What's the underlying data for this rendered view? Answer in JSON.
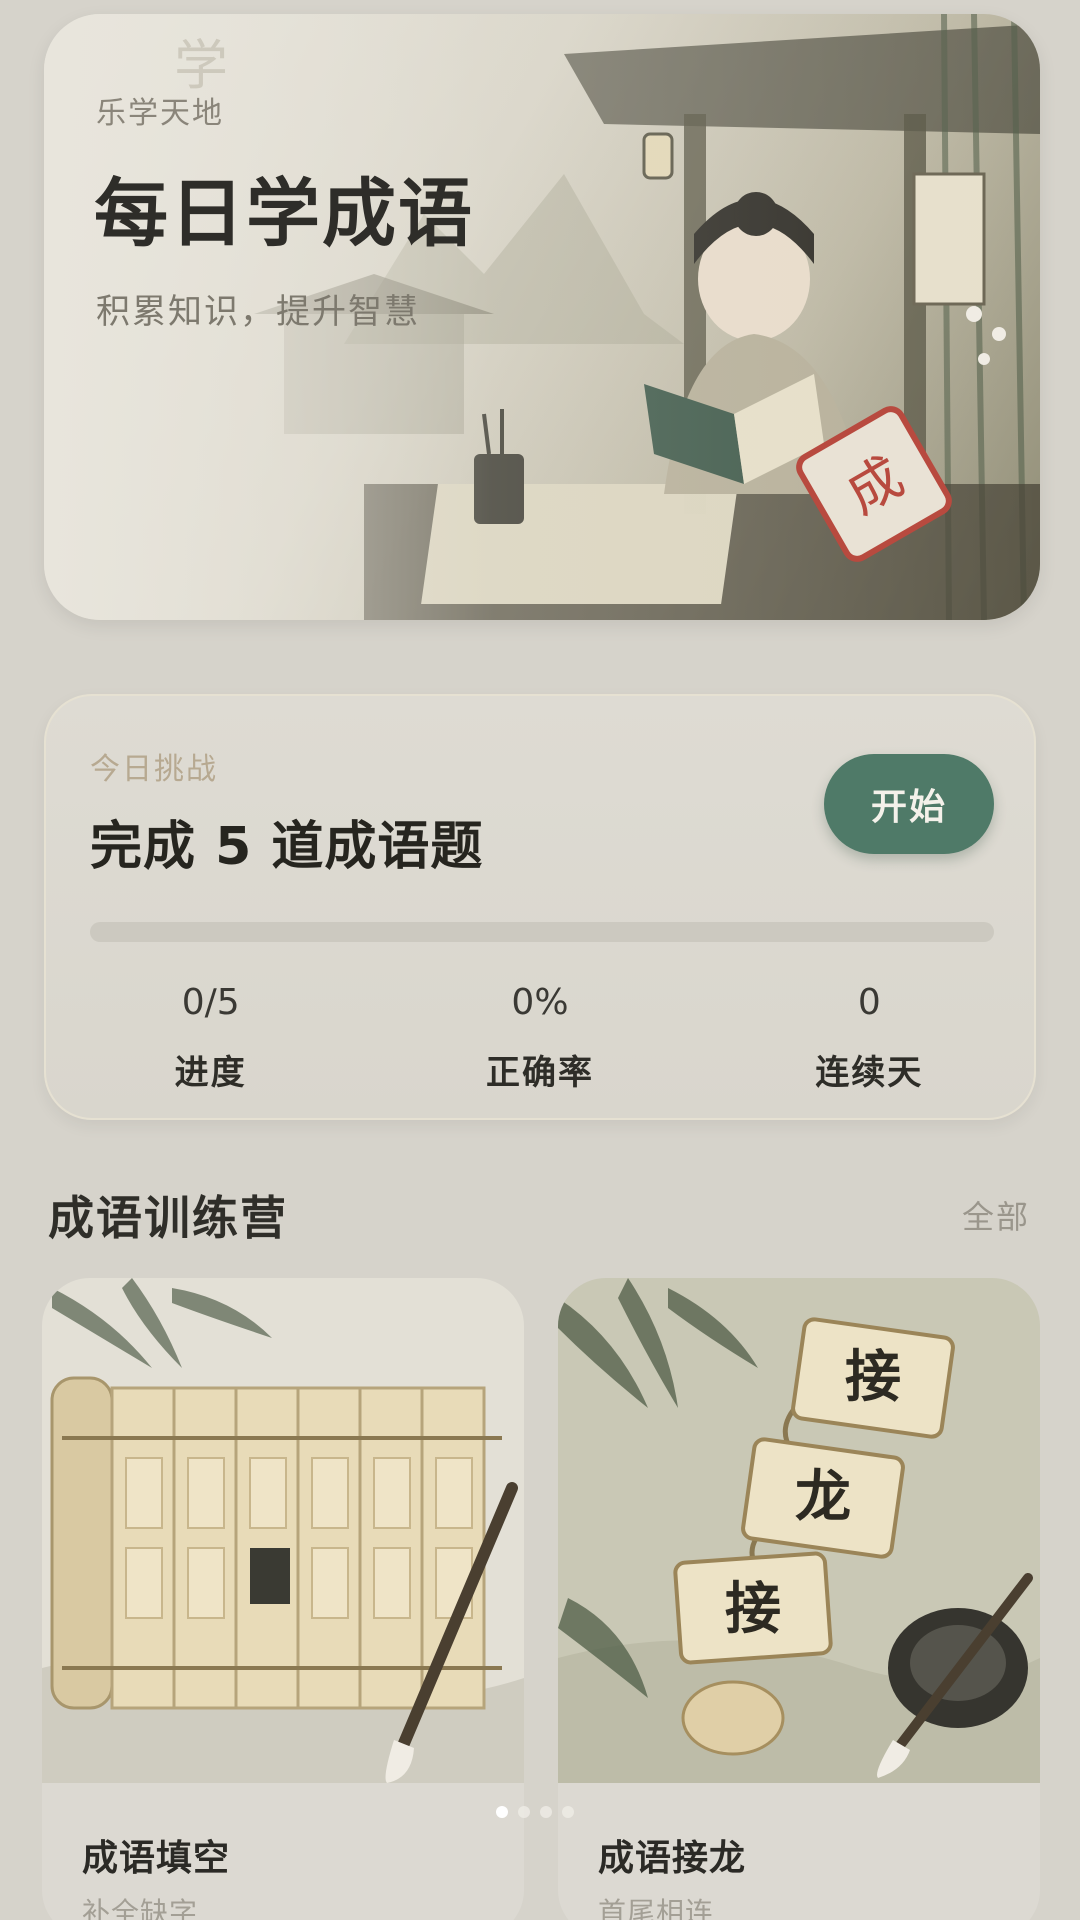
{
  "hero": {
    "eyebrow": "乐学天地",
    "title": "每日学成语",
    "subtitle": "积累知识，提升智慧",
    "seal_char": "成",
    "faint_char": "学"
  },
  "challenge": {
    "eyebrow": "今日挑战",
    "title": "完成 5 道成语题",
    "start_label": "开始",
    "progress": 0,
    "stats": [
      {
        "value": "0/5",
        "label": "进度"
      },
      {
        "value": "0%",
        "label": "正确率"
      },
      {
        "value": "0",
        "label": "连续天"
      }
    ]
  },
  "section": {
    "title": "成语训练营",
    "all_label": "全部"
  },
  "cards": [
    {
      "name": "成语填空",
      "desc": "补全缺字",
      "icon": "scroll-fill-blank-icon"
    },
    {
      "name": "成语接龙",
      "desc": "首尾相连",
      "icon": "scroll-chain-icon",
      "scroll_chars": [
        "接",
        "龙",
        "接"
      ]
    }
  ],
  "pager": {
    "count": 4,
    "active": 0
  },
  "colors": {
    "accent": "#4f7a68",
    "background": "#d6d3cb",
    "seal": "#b84a3f"
  }
}
